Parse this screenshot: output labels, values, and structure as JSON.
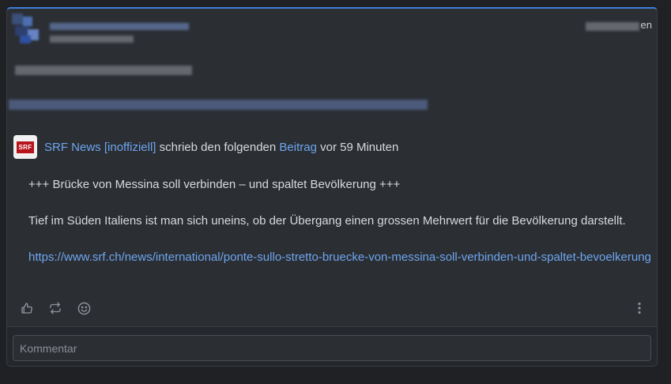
{
  "header": {
    "time_suffix": "en"
  },
  "share": {
    "author_name": "SRF News",
    "author_tag": "[inoffiziell]",
    "wrote_text": "schrieb den folgenden",
    "post_link": "Beitrag",
    "age_text": "vor 59 Minuten",
    "logo_text": "SRF"
  },
  "post": {
    "title": "+++ Brücke von Messina soll verbinden – und spaltet Bevölkerung +++",
    "summary": "Tief im Süden Italiens ist man sich uneins, ob der Übergang einen grossen Mehrwert für die Bevölkerung darstellt.",
    "url": "https://www.srf.ch/news/international/ponte-sullo-stretto-bruecke-von-messina-soll-verbinden-und-spaltet-bevoelkerung"
  },
  "actions": {
    "icons": [
      "thumbs-up-icon",
      "repeat-icon",
      "smiley-icon",
      "more-vertical-icon"
    ]
  },
  "comment": {
    "placeholder": "Kommentar"
  },
  "colors": {
    "accent": "#3d7fd9",
    "link": "#6ea6ef",
    "srf_red": "#b8141c",
    "card_bg": "#2b2e33"
  }
}
